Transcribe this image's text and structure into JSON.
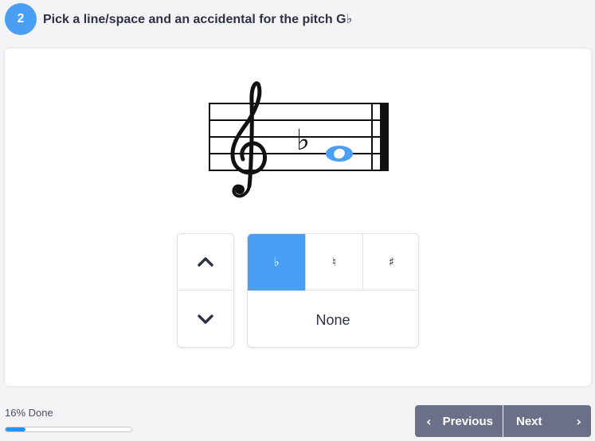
{
  "question": {
    "number": "2",
    "text": "Pick a line/space and an accidental for the pitch G♭"
  },
  "staff": {
    "clef": "treble-clef",
    "note_accidental": "♭",
    "note_color": "#4a9ff5"
  },
  "controls": {
    "up_icon": "chevron-up-icon",
    "down_icon": "chevron-down-icon",
    "accidentals": [
      {
        "label": "♭",
        "name": "flat",
        "selected": true
      },
      {
        "label": "♮",
        "name": "natural",
        "selected": false
      },
      {
        "label": "♯",
        "name": "sharp",
        "selected": false
      }
    ],
    "none_label": "None"
  },
  "progress": {
    "label": "16% Done",
    "percent": 16
  },
  "navigation": {
    "previous_label": "Previous",
    "next_label": "Next"
  },
  "colors": {
    "accent": "#4a9ff5",
    "nav_button": "#6b7088",
    "progress_fill": "#2f8ef0"
  }
}
